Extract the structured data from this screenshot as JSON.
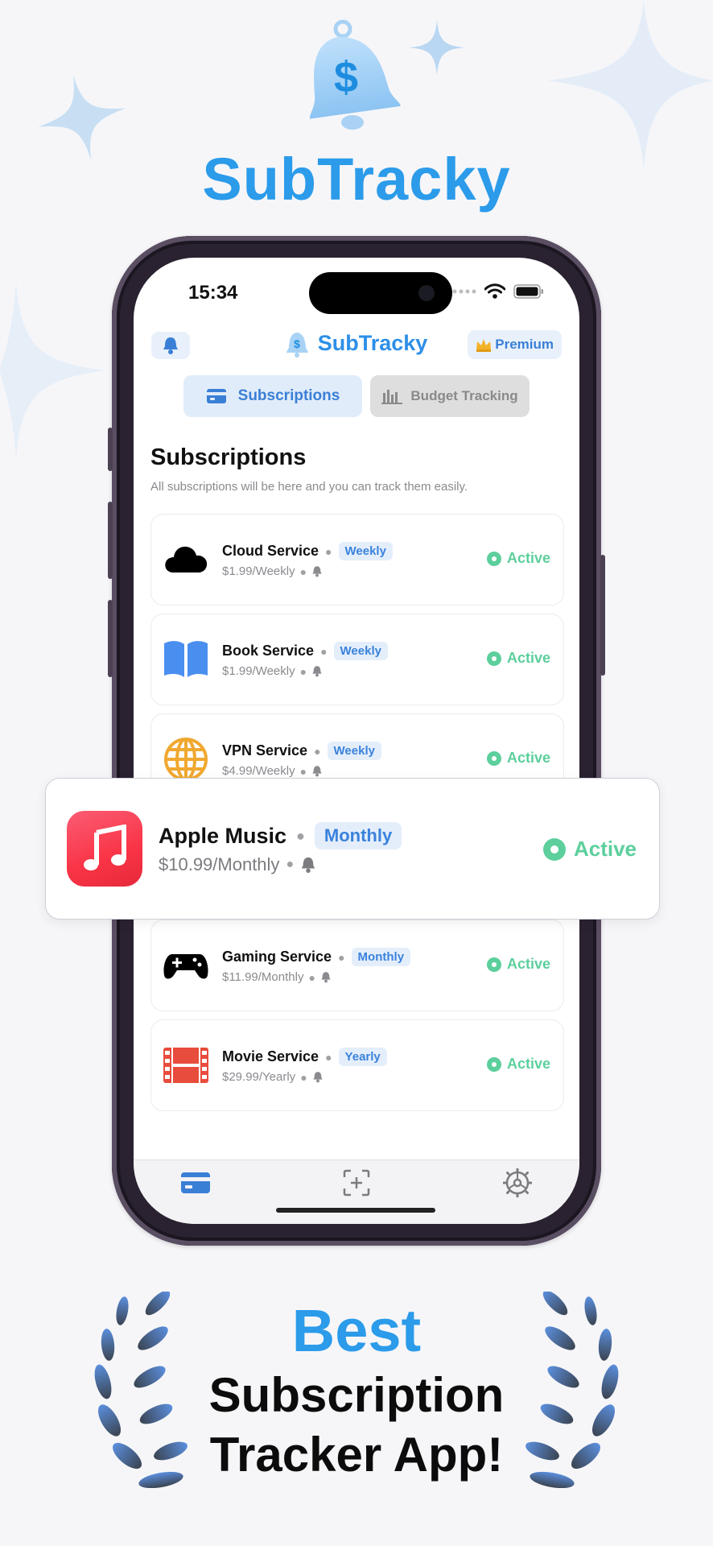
{
  "brand": {
    "title": "SubTracky",
    "accent": "#2b9bea"
  },
  "status_bar": {
    "time": "15:34"
  },
  "header": {
    "app_name": "SubTracky",
    "premium_label": "Premium",
    "premium_icon": "crown-icon",
    "notification_icon": "bell-icon"
  },
  "tabs": [
    {
      "label": "Subscriptions",
      "icon": "card-icon",
      "selected": true
    },
    {
      "label": "Budget Tracking",
      "icon": "bar-chart-icon",
      "selected": false
    }
  ],
  "section": {
    "title": "Subscriptions",
    "subtitle": "All subscriptions will be here and you can track them easily."
  },
  "subscriptions": [
    {
      "name": "Cloud Service",
      "cycle": "Weekly",
      "price": "$1.99/Weekly",
      "status": "Active",
      "icon": "cloud-icon"
    },
    {
      "name": "Book Service",
      "cycle": "Weekly",
      "price": "$1.99/Weekly",
      "status": "Active",
      "icon": "book-icon"
    },
    {
      "name": "VPN Service",
      "cycle": "Weekly",
      "price": "$4.99/Weekly",
      "status": "Active",
      "icon": "globe-icon"
    },
    {
      "name": "Gaming Service",
      "cycle": "Monthly",
      "price": "$11.99/Monthly",
      "status": "Active",
      "icon": "gamepad-icon"
    },
    {
      "name": "Movie Service",
      "cycle": "Yearly",
      "price": "$29.99/Yearly",
      "status": "Active",
      "icon": "film-icon"
    }
  ],
  "highlight": {
    "name": "Apple Music",
    "cycle": "Monthly",
    "price": "$10.99/Monthly",
    "status": "Active",
    "icon": "music-note-icon"
  },
  "tabbar": [
    {
      "icon": "card-icon",
      "selected": true
    },
    {
      "icon": "add-scan-icon",
      "selected": false
    },
    {
      "icon": "settings-icon",
      "selected": false
    }
  ],
  "tagline": {
    "line_best": "Best",
    "line1": "Subscription",
    "line2": "Tracker App!"
  },
  "colors": {
    "active_green": "#5ccf9c",
    "badge_blue": "#3a82dc"
  }
}
